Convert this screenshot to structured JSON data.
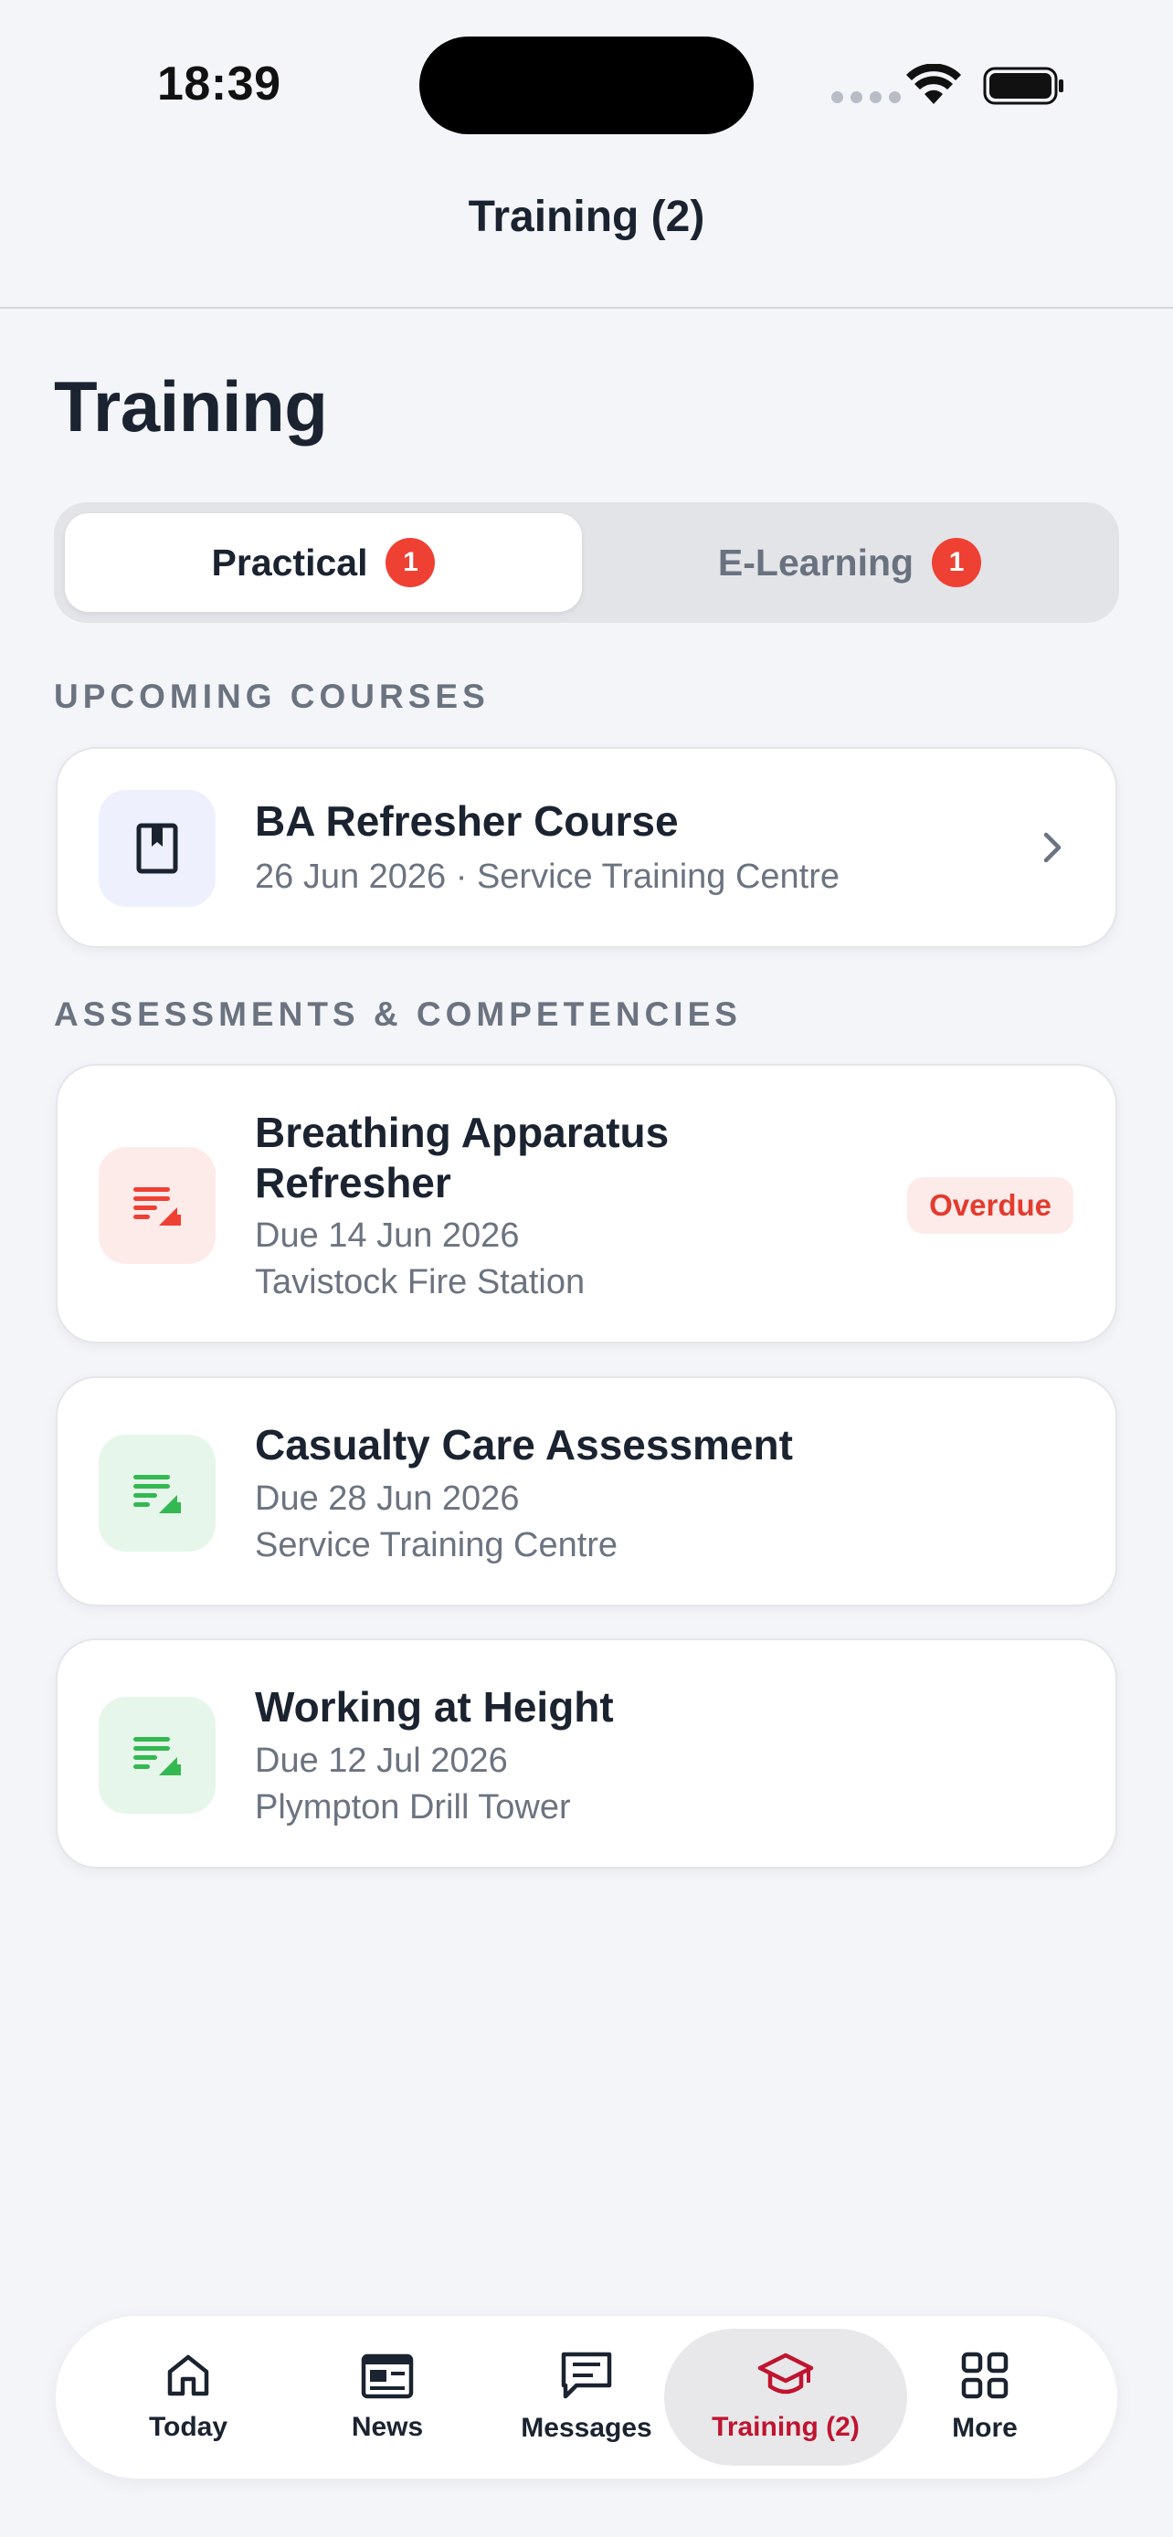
{
  "status_bar": {
    "time": "18:39"
  },
  "nav": {
    "title": "Training (2)"
  },
  "page": {
    "title": "Training"
  },
  "segments": [
    {
      "label": "Practical",
      "badge": "1",
      "active": true
    },
    {
      "label": "E-Learning",
      "badge": "1",
      "active": false
    }
  ],
  "sections": {
    "upcoming": "UPCOMING COURSES",
    "assessments": "ASSESSMENTS & COMPETENCIES"
  },
  "upcoming_courses": [
    {
      "title": "BA Refresher Course",
      "subtitle": "26 Jun 2026 · Service Training Centre",
      "icon": "book-icon"
    }
  ],
  "assessments": [
    {
      "title_line1": "Breathing Apparatus",
      "title_line2": "Refresher",
      "due": "Due 14 Jun 2026",
      "location": "Tavistock Fire Station",
      "status": "Overdue",
      "icon": "assessment-icon",
      "color": "#EF4034"
    },
    {
      "title": "Casualty Care Assessment",
      "due": "Due 28 Jun 2026",
      "location": "Service Training Centre",
      "icon": "assessment-icon",
      "color": "#34B852"
    },
    {
      "title": "Working at Height",
      "due": "Due 12 Jul 2026",
      "location": "Plympton Drill Tower",
      "icon": "assessment-icon",
      "color": "#34B852"
    }
  ],
  "tab_bar": {
    "tabs": [
      {
        "label": "Today",
        "icon": "home-icon"
      },
      {
        "label": "News",
        "icon": "news-icon"
      },
      {
        "label": "Messages",
        "icon": "messages-icon"
      },
      {
        "label": "Training (2)",
        "icon": "graduation-cap-icon",
        "active": true
      },
      {
        "label": "More",
        "icon": "grid-icon"
      }
    ]
  },
  "colors": {
    "accent": "#C0142F",
    "badge_red": "#EF4034",
    "success_green": "#34B852",
    "background": "#F4F5F9"
  }
}
